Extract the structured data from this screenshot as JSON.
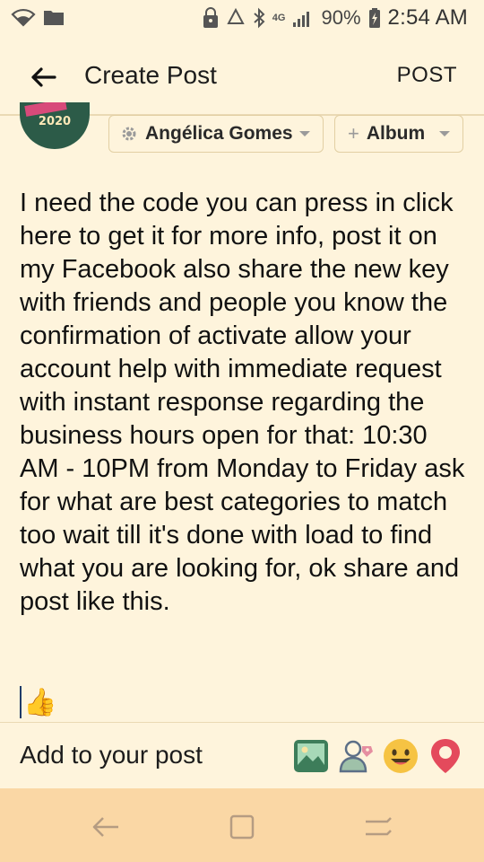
{
  "status_bar": {
    "battery_percent": "90%",
    "time": "2:54 AM",
    "network_label": "4G"
  },
  "app_bar": {
    "title": "Create Post",
    "post_label": "POST"
  },
  "composer": {
    "avatar_year": "2020",
    "privacy_label": "Angélica Gomes",
    "album_label": "Album",
    "album_prefix": "+"
  },
  "post": {
    "body": "I need the code you can press in click here to get it for more info, post it on my Facebook also share the new key with friends and people you know the confirmation of activate allow your account help with immediate request with instant response regarding the business hours open for that: 10:30 AM - 10PM from Monday to Friday ask for what are best categories to match too wait till it's done with load to find what you are looking for, ok share and post like this.",
    "emoji": "👍"
  },
  "add_to_post": {
    "label": "Add to your post",
    "icons": [
      "photo-icon",
      "tag-people-icon",
      "feeling-emoji-icon",
      "location-pin-icon"
    ]
  },
  "nav": {
    "icons": [
      "back-nav-icon",
      "recents-nav-icon",
      "home-nav-icon"
    ]
  },
  "colors": {
    "background": "#fef4dc",
    "nav_background": "#fad7a5",
    "divider": "#ead9b4",
    "photo_icon": "#3d7d5a",
    "location_pin": "#e44a5c",
    "emoji_yellow": "#f6c343"
  }
}
